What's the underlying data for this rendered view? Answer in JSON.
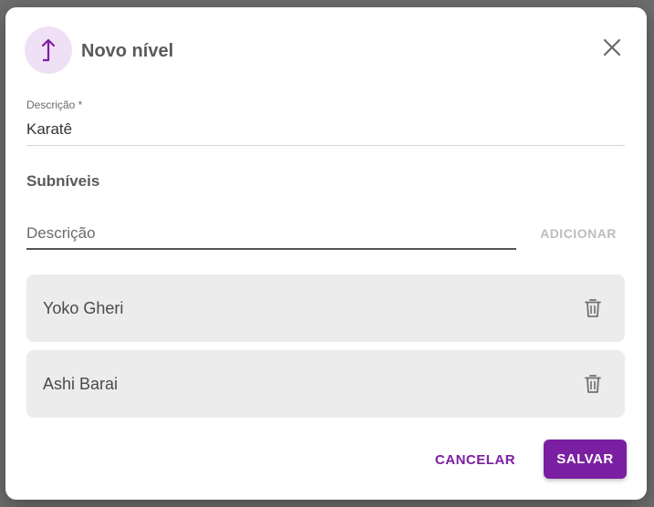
{
  "dialog": {
    "title": "Novo nível",
    "header_icon": "level-up-icon",
    "close_icon": "close-icon"
  },
  "form": {
    "description_label": "Descrição *",
    "description_value": "Karatê"
  },
  "sublevels": {
    "title": "Subníveis",
    "input_placeholder": "Descrição",
    "add_label": "ADICIONAR",
    "items": [
      {
        "label": "Yoko Gheri",
        "icon": "trash-icon"
      },
      {
        "label": "Ashi Barai",
        "icon": "trash-icon"
      }
    ]
  },
  "actions": {
    "cancel_label": "CANCELAR",
    "save_label": "SALVAR"
  },
  "colors": {
    "accent": "#7b1fa2",
    "icon_bg": "#f0e0f5",
    "item_bg": "#ececec"
  }
}
